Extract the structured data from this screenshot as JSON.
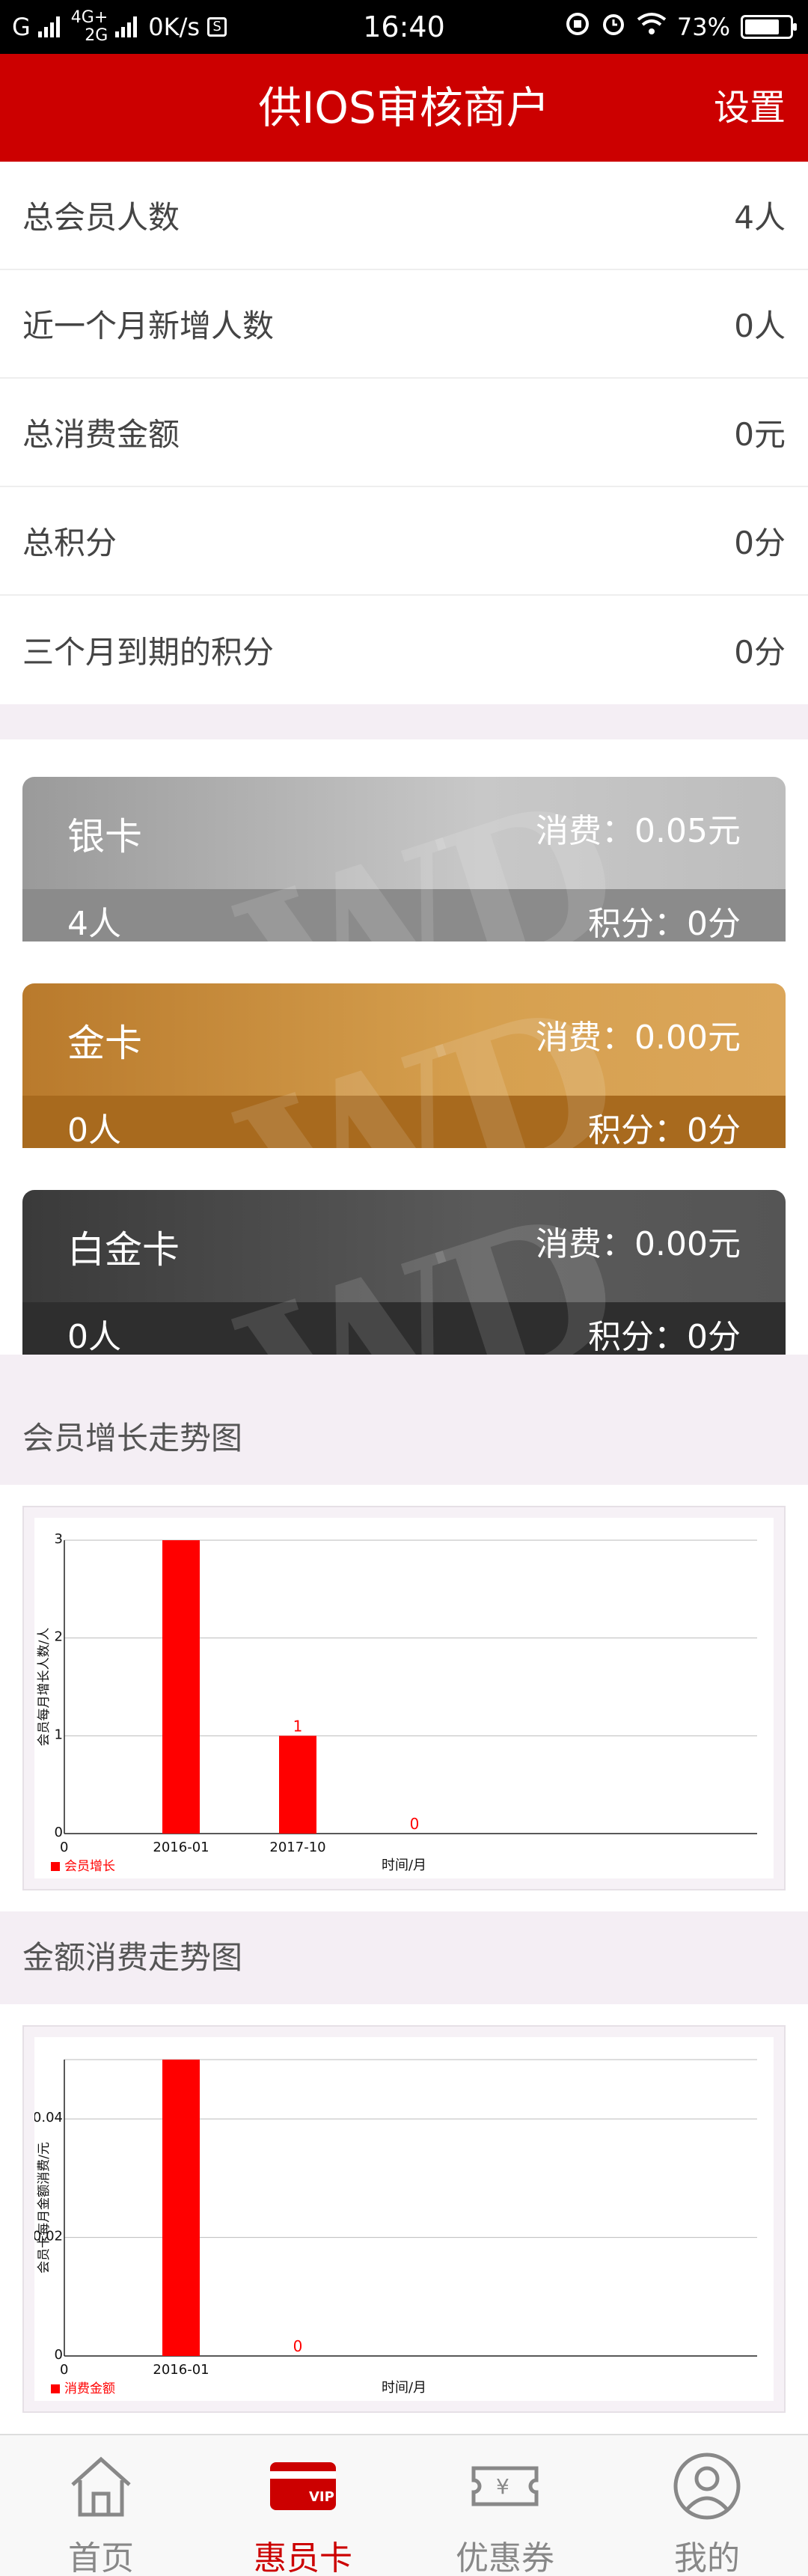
{
  "status_bar": {
    "network": "4G+",
    "network2": "2G",
    "carrier": "G",
    "speed": "0K/s",
    "time": "16:40",
    "battery": "73%"
  },
  "header": {
    "title": "供IOS审核商户",
    "settings_label": "设置"
  },
  "stats": [
    {
      "label": "总会员人数",
      "value": "4人"
    },
    {
      "label": "近一个月新增人数",
      "value": "0人"
    },
    {
      "label": "总消费金额",
      "value": "0元"
    },
    {
      "label": "总积分",
      "value": "0分"
    },
    {
      "label": "三个月到期的积分",
      "value": "0分"
    }
  ],
  "cards": [
    {
      "name": "银卡",
      "spend": "消费：0.05元",
      "count": "4人",
      "points": "积分：0分"
    },
    {
      "name": "金卡",
      "spend": "消费：0.00元",
      "count": "0人",
      "points": "积分：0分"
    },
    {
      "name": "白金卡",
      "spend": "消费：0.00元",
      "count": "0人",
      "points": "积分：0分"
    }
  ],
  "sections": {
    "member_growth": "会员增长走势图",
    "spend_trend": "金额消费走势图"
  },
  "chart_data": [
    {
      "type": "bar",
      "categories": [
        "2016-01",
        "2017-10",
        ""
      ],
      "values": [
        3,
        1,
        0
      ],
      "data_labels": [
        "",
        "1",
        "0"
      ],
      "ylabel": "会员每月增长人数/人",
      "xlabel": "时间/月",
      "legend": "会员增长",
      "legend_position": "bottom-left",
      "ylim": [
        0,
        3
      ],
      "yticks": [
        "0",
        "1",
        "2",
        "3"
      ],
      "x_origin_label": "0",
      "grid": true,
      "color": "#ff0000"
    },
    {
      "type": "bar",
      "categories": [
        "2016-01",
        ""
      ],
      "values": [
        0.05,
        0
      ],
      "data_labels": [
        "",
        "0"
      ],
      "ylabel": "会员卡每月金额消费/元",
      "xlabel": "时间/月",
      "legend": "消费金额",
      "legend_position": "bottom-left",
      "ylim": [
        0,
        0.05
      ],
      "yticks": [
        "0",
        "0.02",
        "0.04"
      ],
      "ytick_values": [
        0,
        0.02,
        0.04
      ],
      "x_origin_label": "0",
      "grid": true,
      "color": "#ff0000"
    }
  ],
  "tabs": [
    {
      "label": "首页",
      "icon": "home-icon",
      "active": false
    },
    {
      "label": "惠员卡",
      "icon": "vip-card-icon",
      "active": true
    },
    {
      "label": "优惠券",
      "icon": "coupon-icon",
      "active": false
    },
    {
      "label": "我的",
      "icon": "profile-icon",
      "active": false
    }
  ],
  "colors": {
    "brand": "#cc0000",
    "chart_bar": "#ff0000"
  }
}
